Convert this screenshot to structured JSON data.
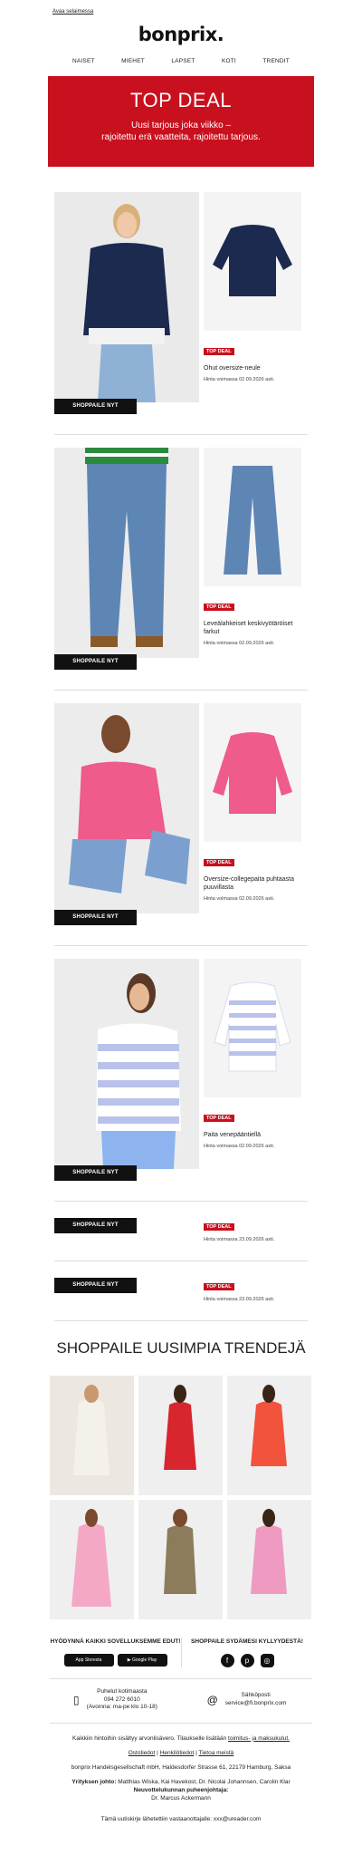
{
  "header": {
    "browser_link": "Avaa selaimessa",
    "logo": "bonprix.",
    "nav": [
      "NAISET",
      "MIEHET",
      "LAPSET",
      "KOTI",
      "TRENDIT"
    ]
  },
  "hero": {
    "title": "TOP DEAL",
    "subtitle_line1": "Uusi tarjous joka viikko –",
    "subtitle_line2": "rajoitettu erä vaatteita, rajoitettu tarjous."
  },
  "products": [
    {
      "badge": "TOP DEAL",
      "name": "Ohut oversize-neule",
      "valid": "Hinta voimassa 02.09.2026 asti.",
      "button": "SHOPPAILE NYT"
    },
    {
      "badge": "TOP DEAL",
      "name": "Leveälahkeiset keskivyötäröiset farkut",
      "valid": "Hinta voimassa 02.09.2026 asti.",
      "button": "SHOPPAILE NYT"
    },
    {
      "badge": "TOP DEAL",
      "name": "Oversize-collegepaita puhtaasta puuvillasta",
      "valid": "Hinta voimassa 02.09.2026 asti.",
      "button": "SHOPPAILE NYT"
    },
    {
      "badge": "TOP DEAL",
      "name": "Paita venepääntiellä",
      "valid": "Hinta voimassa 02.09.2026 asti.",
      "button": "SHOPPAILE NYT"
    }
  ],
  "mini_deals": [
    {
      "badge": "TOP DEAL",
      "valid": "Hinta voimassa 23.09.2026 asti.",
      "button": "SHOPPAILE NYT"
    },
    {
      "badge": "TOP DEAL",
      "valid": "Hinta voimassa 23.09.2026 asti.",
      "button": "SHOPPAILE NYT"
    }
  ],
  "trends": {
    "title": "SHOPPAILE UUSIMPIA TRENDEJÄ"
  },
  "app": {
    "title": "HYÖDYNNÄ KAIKKI SOVELLUKSEMME EDUT!",
    "app_store": "App Storesta",
    "google_play": "Google Play",
    "social_title": "SHOPPAILE SYDÄMESI KYLLYYDESTÄ!"
  },
  "contact": {
    "phone_label": "Puhelut kotimaasta",
    "phone_number": "094 272 6010",
    "phone_hours": "(Avoinna: ma-pe klo 10-18)",
    "email_label": "Sähköposti",
    "email": "service@fi.bonprix.com"
  },
  "footer": {
    "prices_note": "Kaikkiin hintoihin sisältyy arvonlisävero. Tilaukselle lisätään",
    "prices_link": "toimitus- ja maksukulut.",
    "link_ostotiedot": "Ostotiedot",
    "link_henkilotiedot": "Henkilötiedot",
    "link_tietoa": "Tietoa meistä",
    "separator": "|",
    "company": "bonprix Handelsgesellschaft mbH, Haldesdorfer Strasse 61, 22179 Hamburg, Saksa",
    "management_label": "Yrityksen johto:",
    "management": "Matthias Wiska, Kai Havekost, Dr. Nicolai Johannsen, Carolin Klar",
    "board_label": "Neuvottelukunnan puheenjohtaja:",
    "board": "Dr. Marcus Ackermann",
    "recipient": "Tämä uutiskirje lähetettiin vastaanottajalle: xxx@ureader.com"
  },
  "colors": {
    "accent": "#c8101e",
    "button": "#111111"
  }
}
